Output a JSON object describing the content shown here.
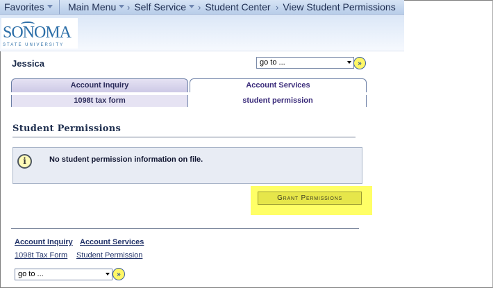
{
  "nav": {
    "favorites": "Favorites",
    "main_menu": "Main Menu",
    "self_service": "Self Service",
    "student_center": "Student Center",
    "view_student_permissions": "View Student Permissions"
  },
  "logo": {
    "name": "SONOMA",
    "sub": "STATE UNIVERSITY",
    "color": "#2d6fa8"
  },
  "student": {
    "name": "Jessica"
  },
  "goto": {
    "label": "go to ..."
  },
  "tabs": [
    {
      "label": "Account Inquiry",
      "active": false
    },
    {
      "label": "Account Services",
      "active": true
    }
  ],
  "subtabs": [
    {
      "label": "1098t tax form",
      "active": false
    },
    {
      "label": "student permission",
      "active": true
    }
  ],
  "section": {
    "title": "Student Permissions"
  },
  "info": {
    "message": "No student permission information on file."
  },
  "grant_button": {
    "label": "Grant Permissions"
  },
  "footer_links": {
    "account_inquiry": "Account Inquiry",
    "account_services": "Account Services",
    "tax_form": "1098t Tax Form",
    "student_permission": "Student Permission"
  },
  "colors": {
    "highlight": "#ffff66",
    "nav_bg": "#c8d8ef"
  }
}
